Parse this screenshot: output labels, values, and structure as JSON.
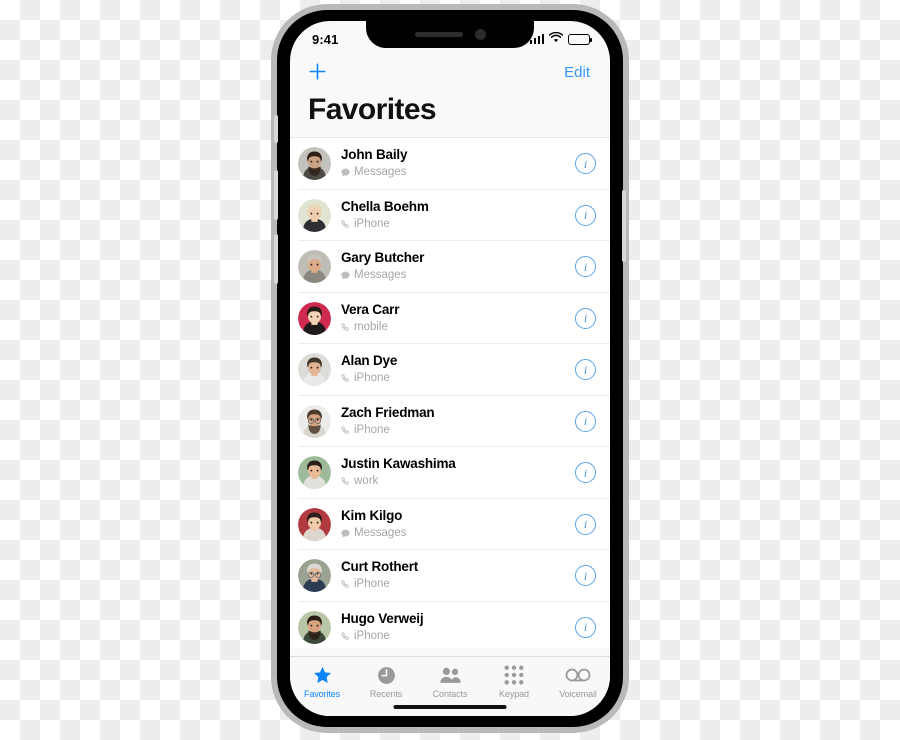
{
  "status_bar": {
    "time": "9:41",
    "signal_icon": "cellular-signal-icon",
    "wifi_icon": "wifi-icon",
    "battery_icon": "battery-icon"
  },
  "nav_bar": {
    "add_label": "+",
    "add_icon": "plus-icon",
    "edit_label": "Edit"
  },
  "title": "Favorites",
  "colors": {
    "accent_blue": "#0a84ff",
    "edit_blue": "#3399ff",
    "info_blue": "#4a93de",
    "subtitle_gray": "#a6a6a6",
    "tab_inactive": "#9a9a9a",
    "screen_bg": "#f9f9f9",
    "list_bg": "#ffffff",
    "separator": "#ececec",
    "frame_outer": "#b9b9b9",
    "frame_inner": "#000000"
  },
  "contacts": [
    {
      "name": "John Baily",
      "subtitle": "Messages",
      "sub_icon": "message-bubble-icon",
      "info_icon": "info-circle-icon",
      "avatar": "avatar-john-baily",
      "skin": "#caa184",
      "hair": "#2e2117",
      "bg": "#c3c2bd",
      "beard": true,
      "glasses": false,
      "shirt": "#4e4a45"
    },
    {
      "name": "Chella Boehm",
      "subtitle": "iPhone",
      "sub_icon": "phone-handset-icon",
      "info_icon": "info-circle-icon",
      "avatar": "avatar-chella-boehm",
      "skin": "#f0cdaf",
      "hair": "#e6d9b6",
      "bg": "#dfe5d2",
      "beard": false,
      "glasses": false,
      "shirt": "#2f2f33"
    },
    {
      "name": "Gary Butcher",
      "subtitle": "Messages",
      "sub_icon": "message-bubble-icon",
      "info_icon": "info-circle-icon",
      "avatar": "avatar-gary-butcher",
      "skin": "#dcab88",
      "hair": "#c9c4bb",
      "bg": "#bfbcb6",
      "beard": false,
      "glasses": false,
      "shirt": "#8c8880"
    },
    {
      "name": "Vera Carr",
      "subtitle": "mobile",
      "sub_icon": "phone-handset-icon",
      "info_icon": "info-circle-icon",
      "avatar": "avatar-vera-carr",
      "skin": "#f3d3b5",
      "hair": "#241a16",
      "bg": "#cf2b50",
      "beard": false,
      "glasses": false,
      "shirt": "#1d1a19"
    },
    {
      "name": "Alan Dye",
      "subtitle": "iPhone",
      "sub_icon": "phone-handset-icon",
      "info_icon": "info-circle-icon",
      "avatar": "avatar-alan-dye",
      "skin": "#e0b393",
      "hair": "#40352a",
      "bg": "#dcdcd8",
      "beard": false,
      "glasses": false,
      "shirt": "#e9e9e7"
    },
    {
      "name": "Zach Friedman",
      "subtitle": "iPhone",
      "sub_icon": "phone-handset-icon",
      "info_icon": "info-circle-icon",
      "avatar": "avatar-zach-friedman",
      "skin": "#d8a583",
      "hair": "#4a3b2d",
      "bg": "#ececea",
      "beard": true,
      "glasses": true,
      "shirt": "#d9d6d0"
    },
    {
      "name": "Justin Kawashima",
      "subtitle": "work",
      "sub_icon": "phone-handset-icon",
      "info_icon": "info-circle-icon",
      "avatar": "avatar-justin-kawashima",
      "skin": "#e6bb95",
      "hair": "#2b2019",
      "bg": "#9dbb9b",
      "beard": false,
      "glasses": false,
      "shirt": "#e2e0da"
    },
    {
      "name": "Kim Kilgo",
      "subtitle": "Messages",
      "sub_icon": "message-bubble-icon",
      "info_icon": "info-circle-icon",
      "avatar": "avatar-kim-kilgo",
      "skin": "#f0cba8",
      "hair": "#2c1d18",
      "bg": "#b03a3f",
      "beard": false,
      "glasses": false,
      "shirt": "#ddd7cf"
    },
    {
      "name": "Curt Rothert",
      "subtitle": "iPhone",
      "sub_icon": "phone-handset-icon",
      "info_icon": "info-circle-icon",
      "avatar": "avatar-curt-rothert",
      "skin": "#e3bb9c",
      "hair": "#dcd9d2",
      "bg": "#9aa392",
      "beard": false,
      "glasses": true,
      "shirt": "#2c3c52"
    },
    {
      "name": "Hugo Verweij",
      "subtitle": "iPhone",
      "sub_icon": "phone-handset-icon",
      "info_icon": "info-circle-icon",
      "avatar": "avatar-hugo-verweij",
      "skin": "#d9a27f",
      "hair": "#2a1d15",
      "bg": "#b9c6a6",
      "beard": true,
      "glasses": false,
      "shirt": "#3a4a3a"
    }
  ],
  "tab_bar": {
    "items": [
      {
        "label": "Favorites",
        "icon": "star-icon",
        "active": true
      },
      {
        "label": "Recents",
        "icon": "clock-icon",
        "active": false
      },
      {
        "label": "Contacts",
        "icon": "people-icon",
        "active": false
      },
      {
        "label": "Keypad",
        "icon": "keypad-icon",
        "active": false
      },
      {
        "label": "Voicemail",
        "icon": "voicemail-icon",
        "active": false
      }
    ]
  }
}
